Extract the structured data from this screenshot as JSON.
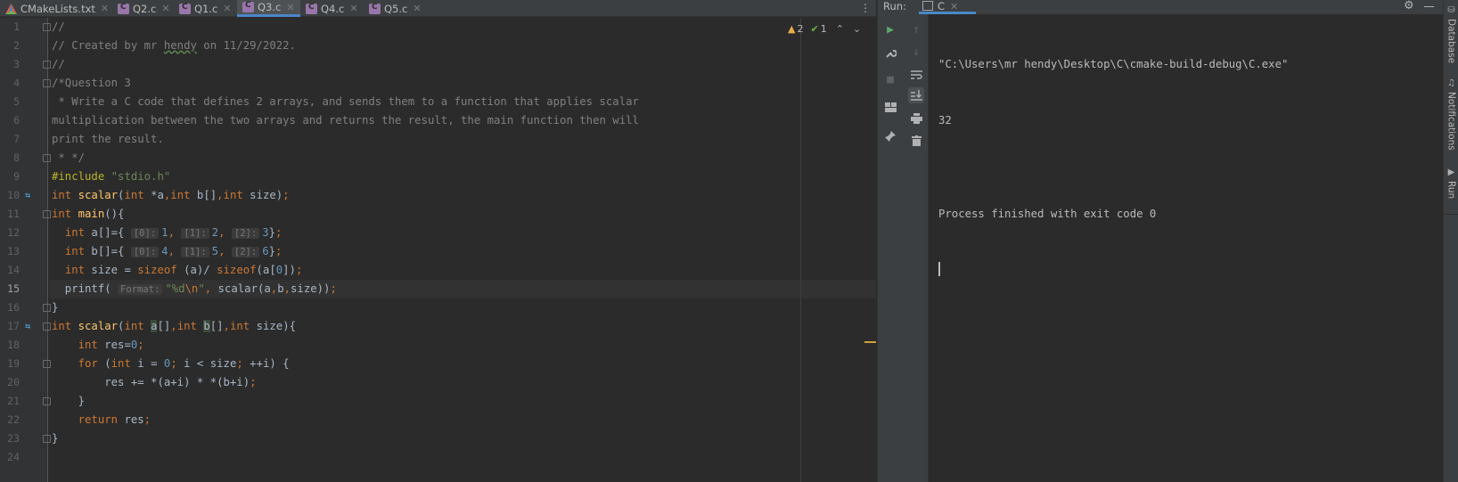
{
  "editor": {
    "tabs": [
      {
        "label": "CMakeLists.txt",
        "icon": "cmake-icon",
        "active": false
      },
      {
        "label": "Q2.c",
        "icon": "c-file-icon",
        "active": false
      },
      {
        "label": "Q1.c",
        "icon": "c-file-icon",
        "active": false
      },
      {
        "label": "Q3.c",
        "icon": "c-file-icon",
        "active": true
      },
      {
        "label": "Q4.c",
        "icon": "c-file-icon",
        "active": false
      },
      {
        "label": "Q5.c",
        "icon": "c-file-icon",
        "active": false
      }
    ],
    "inspection": {
      "warnings": "2",
      "weak_warnings": "1"
    },
    "current_line": 15,
    "line_numbers": [
      "1",
      "2",
      "3",
      "4",
      "5",
      "6",
      "7",
      "8",
      "9",
      "10",
      "11",
      "12",
      "13",
      "14",
      "15",
      "16",
      "17",
      "18",
      "19",
      "20",
      "21",
      "22",
      "23",
      "24"
    ],
    "code": {
      "l1": "//",
      "l2a": "// Created by mr ",
      "l2b": "hendy",
      "l2c": " on 11/29/2022.",
      "l3": "//",
      "l4": "/*Question 3",
      "l5": " * Write a C code that defines 2 arrays, and sends them to a function that applies scalar",
      "l6": "multiplication between the two arrays and returns the result, the main function then will",
      "l7": "print the result.",
      "l8": " * */",
      "l9a": "#include ",
      "l9b": "\"stdio.h\"",
      "kw_int": "int",
      "fn_scalar": "scalar",
      "fn_main": "main",
      "kw_sizeof": "sizeof",
      "kw_for": "for",
      "kw_return": "return",
      "hint0": "[0]:",
      "hint1": "[1]:",
      "hint2": "[2]:",
      "hint_format": "Format:",
      "fmt_str_a": "\"%d",
      "fmt_str_b": "\\n",
      "fmt_str_c": "\""
    }
  },
  "run": {
    "label": "Run:",
    "tab": "C",
    "console": [
      "\"C:\\Users\\mr hendy\\Desktop\\C\\cmake-build-debug\\C.exe\"",
      "32",
      "",
      "Process finished with exit code 0"
    ]
  },
  "stripe": {
    "database": "Database",
    "notifications": "Notifications",
    "run": "Run"
  }
}
